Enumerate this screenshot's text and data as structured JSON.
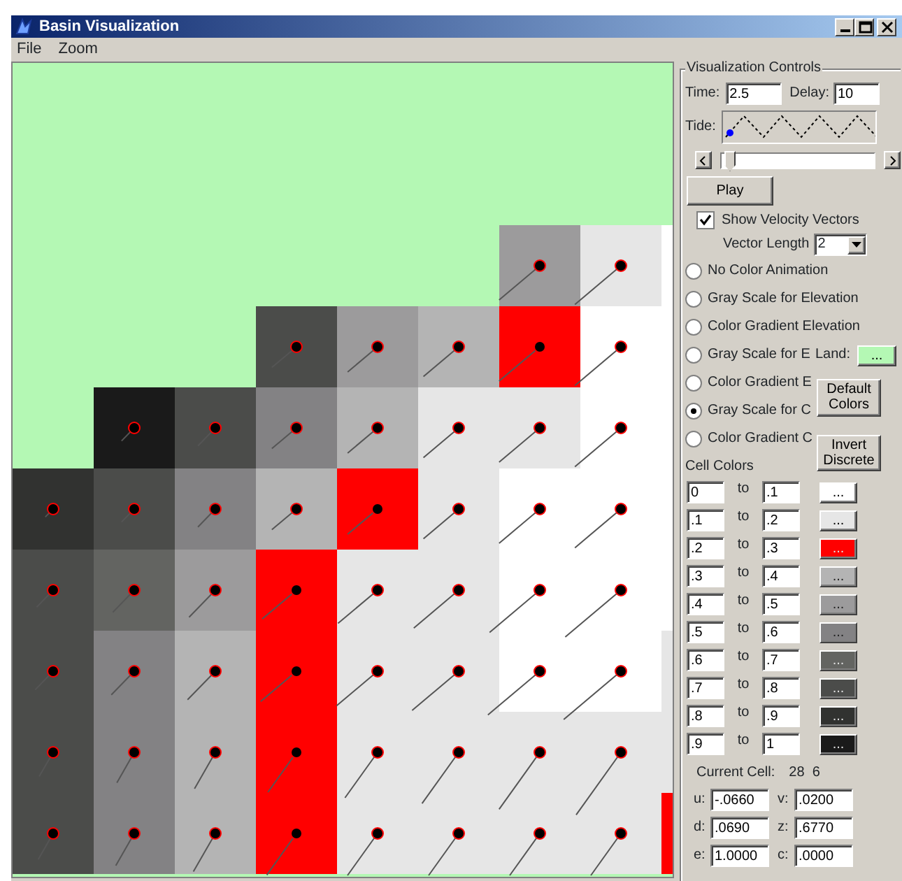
{
  "window": {
    "title": "Basin Visualization"
  },
  "menu": [
    "File",
    "Zoom"
  ],
  "map": {
    "rows": [
      {
        "cells": [
          {
            "kind": "land"
          },
          {
            "kind": "land"
          },
          {
            "kind": "land"
          },
          {
            "kind": "land"
          },
          {
            "kind": "land"
          },
          {
            "kind": "land"
          },
          {
            "kind": "land"
          },
          {
            "kind": "land"
          },
          {
            "kind": "land"
          }
        ]
      },
      {
        "cells": [
          {
            "kind": "land"
          },
          {
            "kind": "land"
          },
          {
            "kind": "land"
          },
          {
            "kind": "land"
          },
          {
            "kind": "land"
          },
          {
            "kind": "land"
          },
          {
            "kind": "land"
          },
          {
            "kind": "land"
          },
          {
            "kind": "land"
          }
        ]
      },
      {
        "cells": [
          {
            "kind": "land"
          },
          {
            "kind": "land"
          },
          {
            "kind": "land"
          },
          {
            "kind": "land"
          },
          {
            "kind": "land"
          },
          {
            "kind": "land"
          },
          {
            "kind": "water",
            "color": "#9c9b9c"
          },
          {
            "kind": "water",
            "color": "#e6e6e6"
          },
          {
            "kind": "water",
            "color": "#ffffff"
          }
        ]
      },
      {
        "cells": [
          {
            "kind": "land"
          },
          {
            "kind": "land"
          },
          {
            "kind": "land"
          },
          {
            "kind": "water",
            "color": "#4b4c4a"
          },
          {
            "kind": "water",
            "color": "#9c9b9c"
          },
          {
            "kind": "water",
            "color": "#b4b4b4"
          },
          {
            "kind": "water",
            "color": "#ff0000"
          },
          {
            "kind": "water",
            "color": "#ffffff"
          },
          {
            "kind": "water",
            "color": "#ffffff"
          }
        ]
      },
      {
        "cells": [
          {
            "kind": "land"
          },
          {
            "kind": "water",
            "color": "#1a1a1a"
          },
          {
            "kind": "water",
            "color": "#4b4c4a"
          },
          {
            "kind": "water",
            "color": "#838284"
          },
          {
            "kind": "water",
            "color": "#b4b4b4"
          },
          {
            "kind": "water",
            "color": "#e6e6e6"
          },
          {
            "kind": "water",
            "color": "#e6e6e6"
          },
          {
            "kind": "water",
            "color": "#ffffff"
          },
          {
            "kind": "water",
            "color": "#ffffff"
          }
        ]
      },
      {
        "cells": [
          {
            "kind": "water",
            "color": "#313230"
          },
          {
            "kind": "water",
            "color": "#4b4c4a"
          },
          {
            "kind": "water",
            "color": "#838284"
          },
          {
            "kind": "water",
            "color": "#b4b4b4"
          },
          {
            "kind": "water",
            "color": "#ff0000"
          },
          {
            "kind": "water",
            "color": "#e6e6e6"
          },
          {
            "kind": "water",
            "color": "#ffffff"
          },
          {
            "kind": "water",
            "color": "#ffffff"
          },
          {
            "kind": "water",
            "color": "#ffffff"
          }
        ]
      },
      {
        "cells": [
          {
            "kind": "water",
            "color": "#4b4c4a"
          },
          {
            "kind": "water",
            "color": "#636461"
          },
          {
            "kind": "water",
            "color": "#9c9b9c"
          },
          {
            "kind": "water",
            "color": "#ff0000"
          },
          {
            "kind": "water",
            "color": "#e6e6e6"
          },
          {
            "kind": "water",
            "color": "#e6e6e6"
          },
          {
            "kind": "water",
            "color": "#ffffff"
          },
          {
            "kind": "water",
            "color": "#ffffff"
          },
          {
            "kind": "water",
            "color": "#ffffff"
          }
        ]
      },
      {
        "cells": [
          {
            "kind": "water",
            "color": "#4b4c4a"
          },
          {
            "kind": "water",
            "color": "#838284"
          },
          {
            "kind": "water",
            "color": "#b4b4b4"
          },
          {
            "kind": "water",
            "color": "#ff0000"
          },
          {
            "kind": "water",
            "color": "#e6e6e6"
          },
          {
            "kind": "water",
            "color": "#e6e6e6"
          },
          {
            "kind": "water",
            "color": "#ffffff"
          },
          {
            "kind": "water",
            "color": "#ffffff"
          },
          {
            "kind": "water",
            "color": "#e6e6e6"
          }
        ]
      },
      {
        "cells": [
          {
            "kind": "water",
            "color": "#4b4c4a"
          },
          {
            "kind": "water",
            "color": "#838284"
          },
          {
            "kind": "water",
            "color": "#b4b4b4"
          },
          {
            "kind": "water",
            "color": "#ff0000"
          },
          {
            "kind": "water",
            "color": "#e6e6e6"
          },
          {
            "kind": "water",
            "color": "#e6e6e6"
          },
          {
            "kind": "water",
            "color": "#e6e6e6"
          },
          {
            "kind": "water",
            "color": "#e6e6e6"
          },
          {
            "kind": "water",
            "color": "#e6e6e6"
          }
        ]
      },
      {
        "cells": [
          {
            "kind": "water",
            "color": "#4b4c4a"
          },
          {
            "kind": "water",
            "color": "#838284"
          },
          {
            "kind": "water",
            "color": "#b4b4b4"
          },
          {
            "kind": "water",
            "color": "#ff0000"
          },
          {
            "kind": "water",
            "color": "#e6e6e6"
          },
          {
            "kind": "water",
            "color": "#e6e6e6"
          },
          {
            "kind": "water",
            "color": "#e6e6e6"
          },
          {
            "kind": "water",
            "color": "#e6e6e6"
          },
          {
            "kind": "water",
            "color": "#ff0000"
          }
        ]
      }
    ]
  },
  "controls": {
    "title": "Visualization Controls",
    "time": {
      "label": "Time:",
      "value": "2.5"
    },
    "delay": {
      "label": "Delay:",
      "value": "10"
    },
    "tide": {
      "label": "Tide:",
      "level": 0.02
    },
    "slider": {
      "level": 0.02
    },
    "play": "Play",
    "show_vectors": {
      "label": "Show Velocity Vectors",
      "checked": true
    },
    "vector_length": {
      "label": "Vector Length",
      "value": "2"
    },
    "color_modes": [
      {
        "label": "No Color Animation",
        "selected": false
      },
      {
        "label": "Gray Scale for Elevation",
        "selected": false
      },
      {
        "label": "Color Gradient Elevation",
        "selected": false
      },
      {
        "label": "Gray Scale for E",
        "selected": false
      },
      {
        "label": "Color Gradient E",
        "selected": false
      },
      {
        "label": "Gray Scale for C",
        "selected": true
      },
      {
        "label": "Color Gradient C",
        "selected": false
      }
    ],
    "land": {
      "label": "Land:",
      "button": "...",
      "color": "#b4f8b4"
    },
    "default_colors": "Default Colors",
    "invert": "Invert Discrete",
    "cell_colors": {
      "title": "Cell Colors",
      "rows": [
        {
          "from": "0",
          "to_label": "to",
          "to": ".1",
          "button": "...",
          "color": "#ffffff"
        },
        {
          "from": ".1",
          "to_label": "to",
          "to": ".2",
          "button": "...",
          "color": "#e6e6e6"
        },
        {
          "from": ".2",
          "to_label": "to",
          "to": ".3",
          "button": "...",
          "color": "#ff0000"
        },
        {
          "from": ".3",
          "to_label": "to",
          "to": ".4",
          "button": "...",
          "color": "#b4b4b4"
        },
        {
          "from": ".4",
          "to_label": "to",
          "to": ".5",
          "button": "...",
          "color": "#9c9b9c"
        },
        {
          "from": ".5",
          "to_label": "to",
          "to": ".6",
          "button": "...",
          "color": "#838284"
        },
        {
          "from": ".6",
          "to_label": "to",
          "to": ".7",
          "button": "...",
          "color": "#636461"
        },
        {
          "from": ".7",
          "to_label": "to",
          "to": ".8",
          "button": "...",
          "color": "#4b4c4a"
        },
        {
          "from": ".8",
          "to_label": "to",
          "to": ".9",
          "button": "...",
          "color": "#313230"
        },
        {
          "from": ".9",
          "to_label": "to",
          "to": "1",
          "button": "...",
          "color": "#1a1a1a"
        }
      ]
    },
    "current_cell": {
      "label": "Current Cell:",
      "value": "28  6"
    },
    "readouts": [
      {
        "label": "u:",
        "value": "-.0660"
      },
      {
        "label": "v:",
        "value": ".0200"
      },
      {
        "label": "d:",
        "value": ".0690"
      },
      {
        "label": "z:",
        "value": ".6770"
      },
      {
        "label": "e:",
        "value": "1.0000"
      },
      {
        "label": "c:",
        "value": ".0000"
      }
    ]
  }
}
